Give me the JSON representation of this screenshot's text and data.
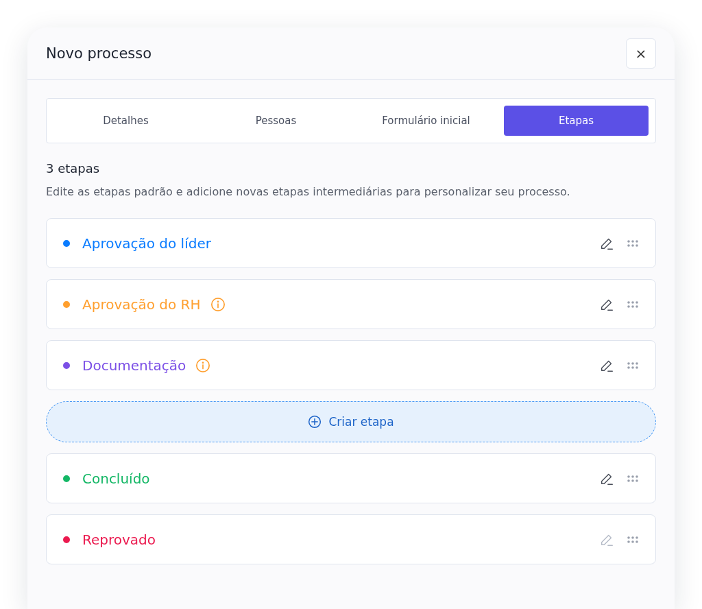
{
  "dialog": {
    "title": "Novo processo",
    "close_label": "×"
  },
  "tabs": [
    {
      "label": "Detalhes",
      "selected": false
    },
    {
      "label": "Pessoas",
      "selected": false
    },
    {
      "label": "Formulário inicial",
      "selected": false
    },
    {
      "label": "Etapas",
      "selected": true
    }
  ],
  "section": {
    "heading": "3 etapas",
    "description": "Edite as etapas padrão e adicione novas etapas intermediárias para personalizar seu processo."
  },
  "stages": [
    {
      "kind": "stage",
      "name": "Aprovação do líder",
      "color": "#0a7cff",
      "info": false,
      "edit_disabled": false
    },
    {
      "kind": "stage",
      "name": "Aprovação do RH",
      "color": "#ff9f2e",
      "info": true,
      "edit_disabled": false
    },
    {
      "kind": "stage",
      "name": "Documentação",
      "color": "#7b4fe6",
      "info": true,
      "edit_disabled": false
    },
    {
      "kind": "add",
      "label": "Criar etapa"
    },
    {
      "kind": "stage",
      "name": "Concluído",
      "color": "#13b765",
      "info": false,
      "edit_disabled": false
    },
    {
      "kind": "stage",
      "name": "Reprovado",
      "color": "#eb1a4f",
      "info": false,
      "edit_disabled": true
    }
  ]
}
